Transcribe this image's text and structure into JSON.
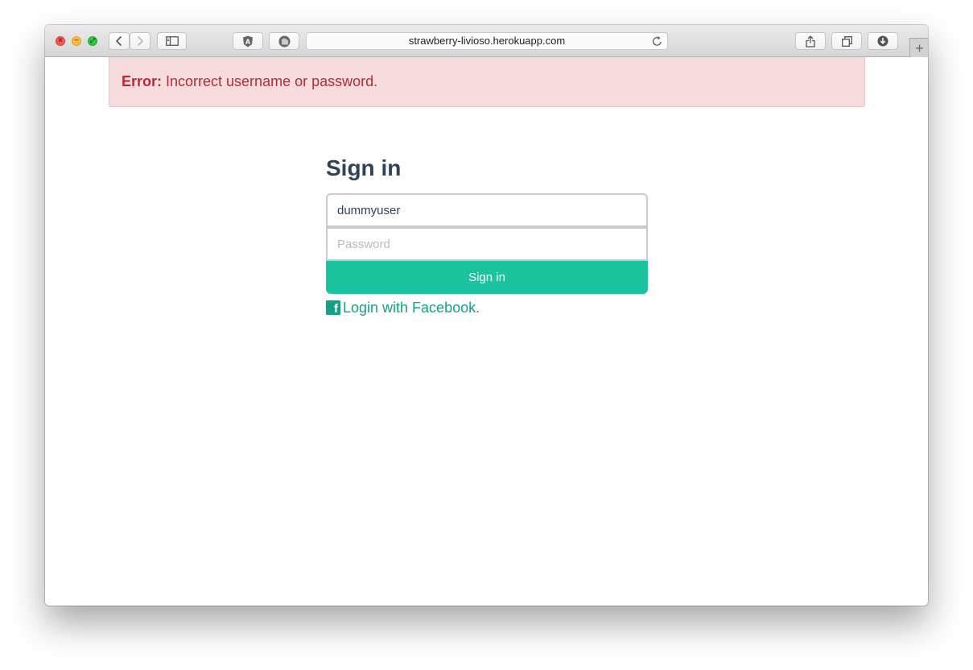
{
  "browser": {
    "url": "strawberry-livioso.herokuapp.com",
    "icons": [
      "back-icon",
      "forward-icon",
      "sidebar-icon",
      "shield-icon",
      "hand-icon",
      "reload-icon",
      "share-icon",
      "tabs-icon",
      "download-icon",
      "plus-icon"
    ],
    "newtab_label": "+"
  },
  "alert": {
    "label": "Error:",
    "message": "Incorrect username or password.",
    "color": "#b72b36",
    "background": "#f6dcdc"
  },
  "form": {
    "title": "Sign in",
    "username": {
      "value": "dummyuser"
    },
    "password": {
      "placeholder": "Password",
      "value": ""
    },
    "submit_label": "Sign in",
    "facebook_icon": "f",
    "facebook_label": "Login with Facebook."
  },
  "colors": {
    "accent": "#1bc49f",
    "link": "#16a085",
    "heading": "#2c4359"
  }
}
